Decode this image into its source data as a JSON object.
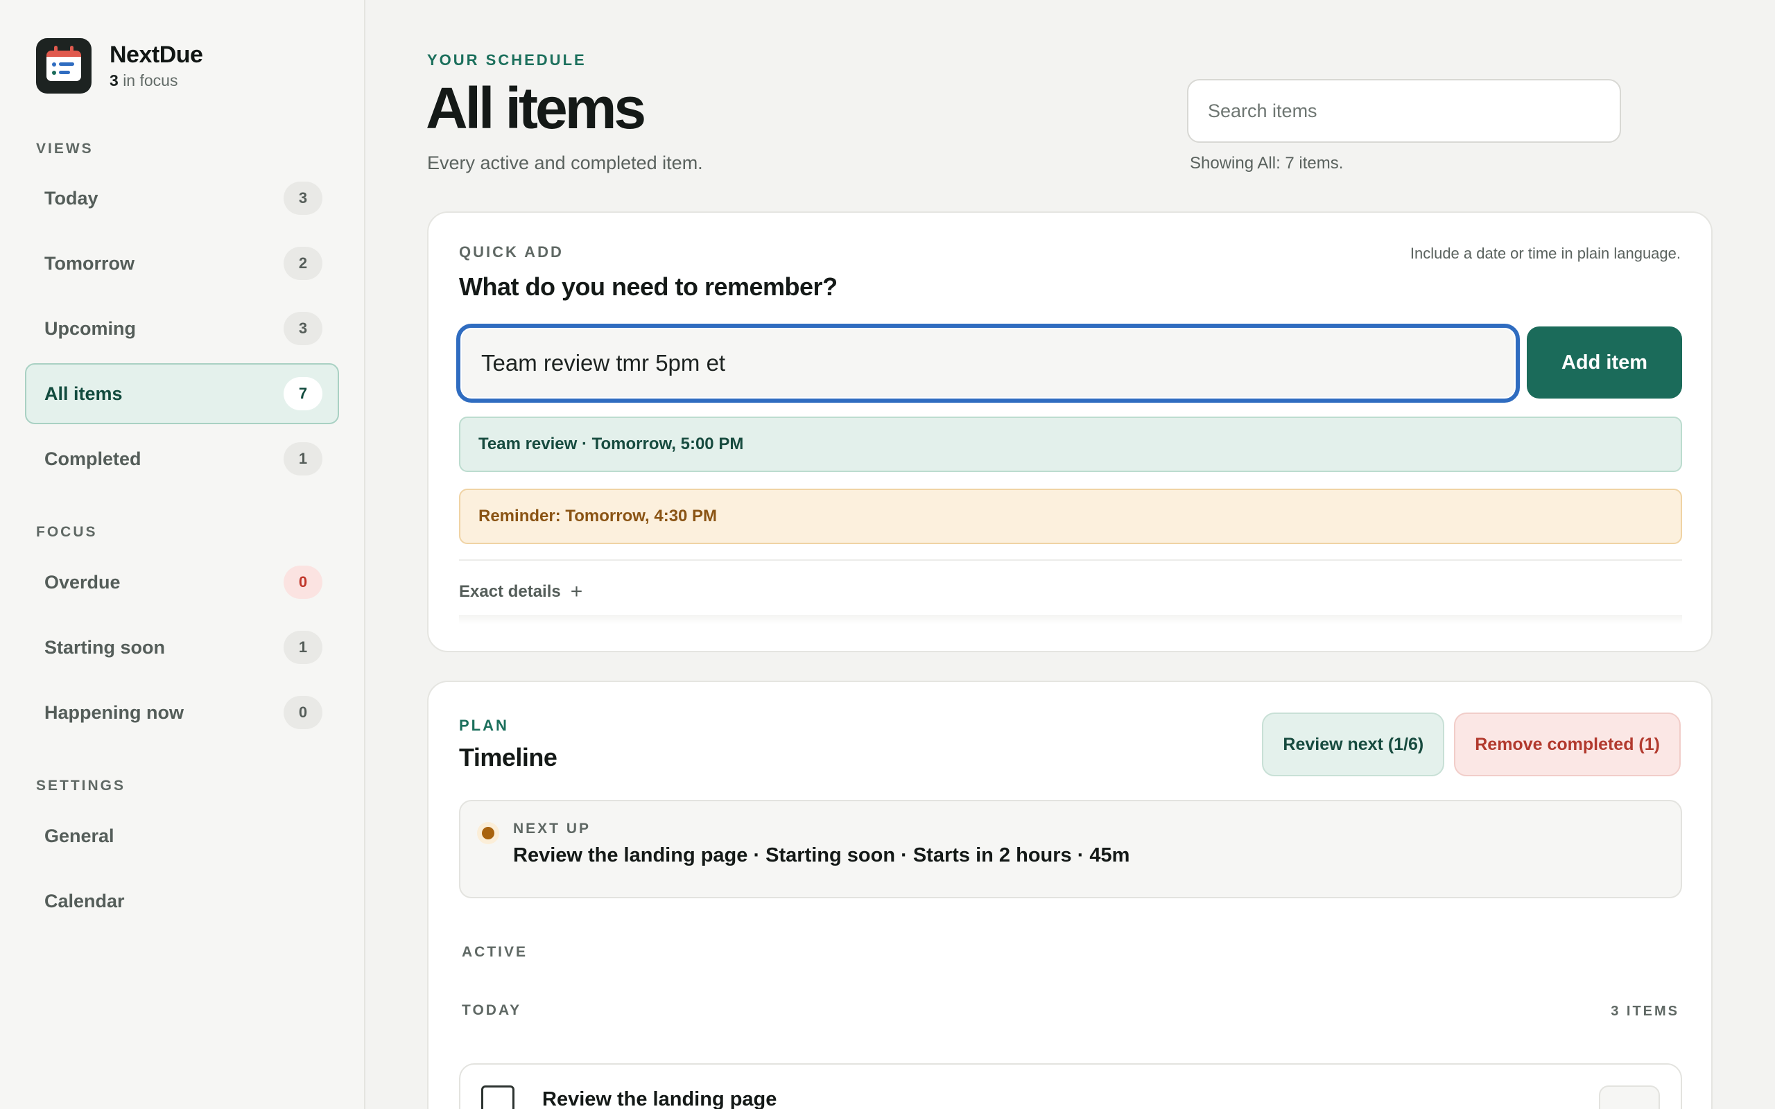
{
  "app": {
    "name": "NextDue",
    "focus_count": "3",
    "focus_suffix": "in focus"
  },
  "sidebar": {
    "views_label": "VIEWS",
    "views": [
      {
        "label": "Today",
        "count": "3"
      },
      {
        "label": "Tomorrow",
        "count": "2"
      },
      {
        "label": "Upcoming",
        "count": "3"
      },
      {
        "label": "All items",
        "count": "7",
        "active": true
      },
      {
        "label": "Completed",
        "count": "1"
      }
    ],
    "focus_label": "FOCUS",
    "focus": [
      {
        "label": "Overdue",
        "count": "0"
      },
      {
        "label": "Starting soon",
        "count": "1"
      },
      {
        "label": "Happening now",
        "count": "0"
      }
    ],
    "settings_label": "SETTINGS",
    "settings": [
      {
        "label": "General"
      },
      {
        "label": "Calendar"
      }
    ]
  },
  "header": {
    "eyebrow": "YOUR SCHEDULE",
    "title": "All items",
    "subtitle": "Every active and completed item.",
    "search_placeholder": "Search items",
    "search_status": "Showing All: 7 items."
  },
  "quick_add": {
    "eyebrow": "QUICK ADD",
    "hint": "Include a date or time in plain language.",
    "title": "What do you need to remember?",
    "input_value": "Team review tmr 5pm et",
    "add_button": "Add item",
    "parsed_time": "Team review · Tomorrow, 5:00 PM",
    "parsed_reminder": "Reminder: Tomorrow, 4:30 PM",
    "exact_details": "Exact details",
    "exact_details_icon": "plus-icon"
  },
  "plan": {
    "eyebrow": "PLAN",
    "title": "Timeline",
    "review_button": "Review next (1/6)",
    "remove_button": "Remove completed (1)",
    "next_up_label": "NEXT UP",
    "next_up_title": "Review the landing page · Starting soon · Starts in 2 hours · 45m",
    "active_label": "ACTIVE",
    "today_label": "TODAY",
    "today_count": "3 ITEMS",
    "tasks": [
      {
        "title": "Review the landing page"
      }
    ]
  },
  "colors": {
    "accent": "#1b6b5a",
    "focus_ring": "#2f6cc0",
    "danger": "#c0372b",
    "warning": "#a8630f"
  }
}
